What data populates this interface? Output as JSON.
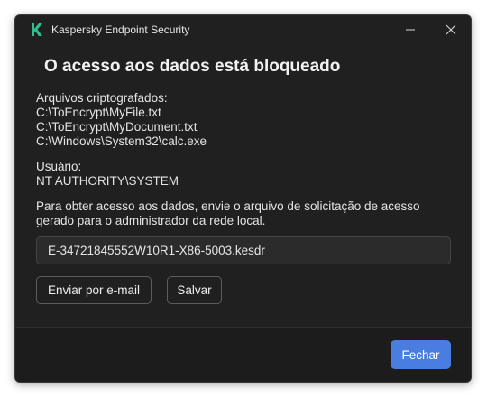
{
  "window": {
    "app_title": "Kaspersky Endpoint Security",
    "logo_icon": "kaspersky-k-logo",
    "minimize_icon": "minimize-icon",
    "close_icon": "close-icon",
    "accent_color": "#2fbf8f"
  },
  "dialog": {
    "heading": "O acesso aos dados está bloqueado",
    "files_label": "Arquivos criptografados:",
    "files": [
      "C:\\ToEncrypt\\MyFile.txt",
      "C:\\ToEncrypt\\MyDocument.txt",
      "C:\\Windows\\System32\\calc.exe"
    ],
    "user_label": "Usuário:",
    "user_value": "NT AUTHORITY\\SYSTEM",
    "info_text": "Para obter acesso aos dados, envie o arquivo de solicitação de acesso gerado para o administrador da rede local.",
    "request_file": "E-34721845552W10R1-X86-5003.kesdr"
  },
  "buttons": {
    "email_label": "Enviar por e-mail",
    "save_label": "Salvar",
    "close_label": "Fechar",
    "primary_color": "#4a7de0"
  }
}
